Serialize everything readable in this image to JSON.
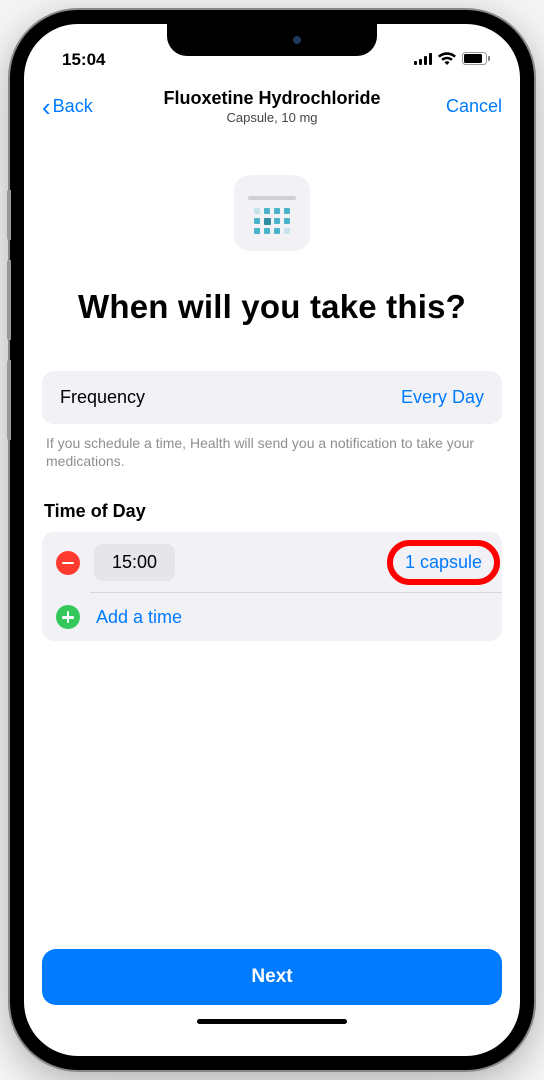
{
  "status": {
    "time": "15:04"
  },
  "nav": {
    "back_label": "Back",
    "title": "Fluoxetine Hydrochloride",
    "subtitle": "Capsule, 10 mg",
    "cancel_label": "Cancel"
  },
  "heading": "When will you take this?",
  "frequency": {
    "label": "Frequency",
    "value": "Every Day"
  },
  "help_text": "If you schedule a time, Health will send you a notification to take your medications.",
  "time_section": {
    "title": "Time of Day",
    "entries": [
      {
        "time": "15:00",
        "dose": "1 capsule"
      }
    ],
    "add_label": "Add a time"
  },
  "next_label": "Next"
}
